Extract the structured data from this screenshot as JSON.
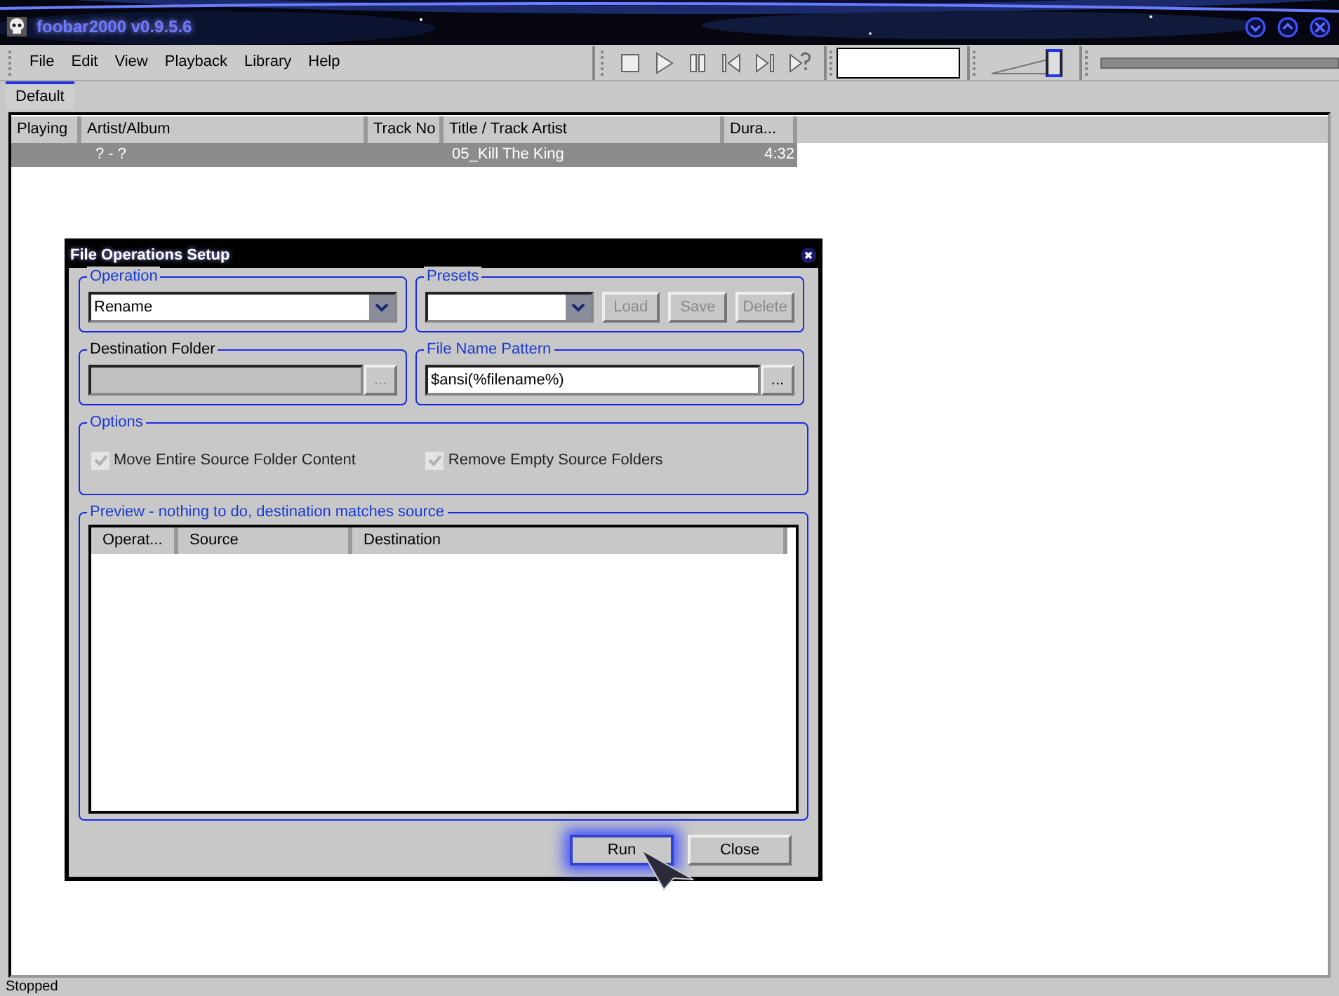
{
  "window": {
    "title": "foobar2000 v0.9.5.6"
  },
  "menu": [
    "File",
    "Edit",
    "View",
    "Playback",
    "Library",
    "Help"
  ],
  "transport": [
    {
      "kind": "stop"
    },
    {
      "kind": "play"
    },
    {
      "kind": "pause"
    },
    {
      "kind": "previous"
    },
    {
      "kind": "next"
    },
    {
      "kind": "random"
    }
  ],
  "volume": {
    "level": 0.95
  },
  "tabs": [
    {
      "label": "Default",
      "selected": true
    }
  ],
  "playlist": {
    "columns": [
      "Playing",
      "Artist/Album",
      "Track No",
      "Title / Track Artist",
      "Dura..."
    ],
    "rows": [
      {
        "cells": [
          "",
          "? - ?",
          "",
          "05_Kill The King",
          "4:32"
        ],
        "selected": true
      }
    ]
  },
  "dialog": {
    "title": "File Operations Setup",
    "operation": {
      "label": "Operation",
      "value": "Rename"
    },
    "presets": {
      "label": "Presets",
      "buttons": [
        {
          "label": "Load",
          "disabled": true
        },
        {
          "label": "Save",
          "disabled": true
        },
        {
          "label": "Delete",
          "disabled": true
        }
      ]
    },
    "destination": {
      "label": "Destination Folder",
      "disabled": true,
      "browse": "..."
    },
    "pattern": {
      "label": "File Name Pattern",
      "value": "$ansi(%filename%)",
      "disabled": false,
      "browse": "..."
    },
    "options": {
      "label": "Options",
      "items": [
        {
          "label": "Move Entire Source Folder Content",
          "checked": true,
          "disabled": true
        },
        {
          "label": "Remove Empty Source Folders",
          "checked": true,
          "disabled": true
        }
      ]
    },
    "preview": {
      "label": "Preview - nothing to do, destination matches source",
      "columns": [
        "Operat...",
        "Source",
        "Destination"
      ]
    },
    "buttons": [
      {
        "label": "Run",
        "default": true
      },
      {
        "label": "Close",
        "default": false
      }
    ]
  },
  "status_bar": "Stopped"
}
